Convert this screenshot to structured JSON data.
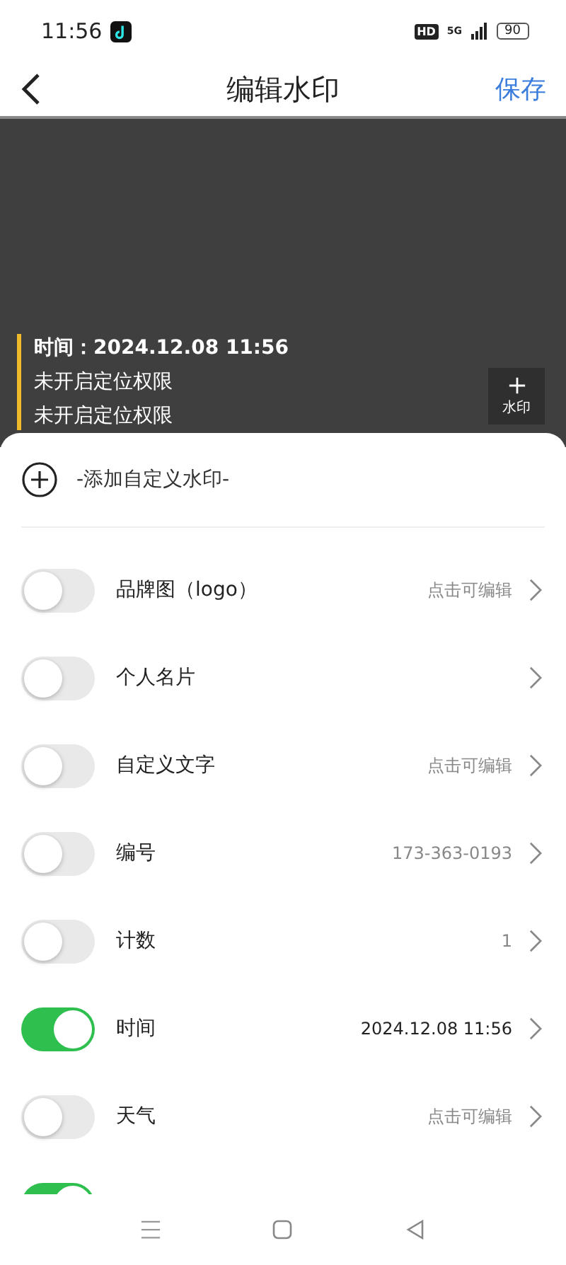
{
  "status_bar": {
    "time": "11:56",
    "hd": "HD",
    "network": "5G",
    "battery": "90"
  },
  "header": {
    "title": "编辑水印",
    "action": "保存"
  },
  "preview": {
    "lines": [
      "时间：2024.12.08 11:56",
      "未开启定位权限",
      "未开启定位权限"
    ],
    "add_button": "水印"
  },
  "add_custom": "-添加自定义水印-",
  "items": [
    {
      "label": "品牌图（logo）",
      "value": "点击可编辑",
      "on": false
    },
    {
      "label": "个人名片",
      "on": false
    },
    {
      "label": "自定义文字",
      "value": "点击可编辑",
      "on": false
    },
    {
      "label": "编号",
      "value": "173-363-0193",
      "on": false
    },
    {
      "label": "计数",
      "value": "1",
      "on": false
    },
    {
      "label": "时间",
      "value": "2024.12.08 11:56",
      "on": true
    },
    {
      "label": "天气",
      "value": "点击可编辑",
      "on": false
    },
    {
      "on": true
    }
  ]
}
